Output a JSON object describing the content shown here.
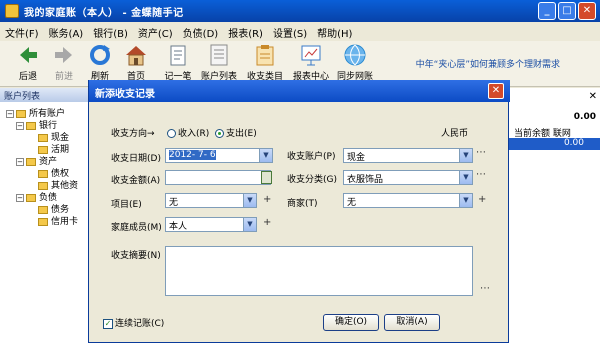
{
  "window": {
    "title": "我的家庭账（本人） - 金蝶随手记"
  },
  "menu": [
    "文件(F)",
    "账务(A)",
    "银行(B)",
    "资产(C)",
    "负债(D)",
    "报表(R)",
    "设置(S)",
    "帮助(H)"
  ],
  "toolbar": [
    {
      "label": "后退",
      "icon": "back-arrow-icon",
      "color": "#2f8f3a"
    },
    {
      "label": "前进",
      "icon": "forward-arrow-icon",
      "color": "#a8a8a8"
    },
    {
      "label": "刷新",
      "icon": "refresh-icon",
      "color": "#2a78d6"
    },
    {
      "label": "首页",
      "icon": "home-icon",
      "color": "#b34a2a"
    },
    {
      "label": "记一笔",
      "icon": "pencil-icon",
      "color": "#6a7a8a"
    },
    {
      "label": "账户列表",
      "icon": "account-list-icon",
      "color": "#8a8a8a"
    },
    {
      "label": "收支类目",
      "icon": "category-icon",
      "color": "#c98a2a"
    },
    {
      "label": "报表中心",
      "icon": "report-icon",
      "color": "#3a7ac8"
    },
    {
      "label": "同步网账",
      "icon": "sync-globe-icon",
      "color": "#2a8ad0"
    }
  ],
  "promo": "中年“夹心层”如何兼顾多个理财需求",
  "left_panel": {
    "title": "账户列表",
    "tree": [
      {
        "label": "所有账户",
        "level": 0
      },
      {
        "label": "银行",
        "level": 1
      },
      {
        "label": "现金",
        "level": 2
      },
      {
        "label": "活期",
        "level": 2
      },
      {
        "label": "资产",
        "level": 1
      },
      {
        "label": "债权",
        "level": 2
      },
      {
        "label": "其他资",
        "level": 2
      },
      {
        "label": "负债",
        "level": 1
      },
      {
        "label": "债务",
        "level": 2
      },
      {
        "label": "信用卡",
        "level": 2
      }
    ]
  },
  "right_panel": {
    "total": "0.00",
    "columns": "当前余额 联网",
    "selected_value": "0.00"
  },
  "dialog": {
    "title": "新添收支记录",
    "direction_label": "收支方向→",
    "income_label": "收入(R)",
    "expense_label": "支出(E)",
    "currency": "人民币",
    "date_label": "收支日期(D)",
    "date_value": "2012- 7- 6",
    "account_label": "收支账户(P)",
    "account_value": "现金",
    "amount_label": "收支金额(A)",
    "amount_value": "",
    "category_label": "收支分类(G)",
    "category_value": "衣服饰品",
    "project_label": "项目(E)",
    "project_value": "无",
    "merchant_label": "商家(T)",
    "merchant_value": "无",
    "member_label": "家庭成员(M)",
    "member_value": "本人",
    "summary_label": "收支摘要(N)",
    "summary_value": "",
    "continuous_label": "连续记账(C)",
    "ok_label": "确定(O)",
    "cancel_label": "取消(A)"
  }
}
